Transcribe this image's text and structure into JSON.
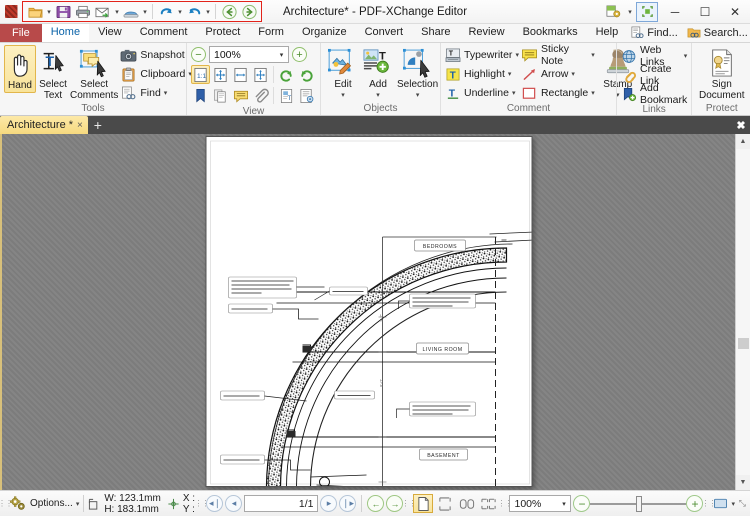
{
  "window": {
    "title": "Architecture* - PDF-XChange Editor",
    "minimize": "─",
    "maximize": "☐",
    "close": "✕"
  },
  "quick_access": {
    "icons": [
      "open-folder-icon",
      "save-icon",
      "print-icon",
      "email-icon",
      "scan-icon",
      "undo-icon",
      "redo-icon",
      "back-icon",
      "forward-icon"
    ]
  },
  "menu": {
    "file_label": "File",
    "tabs": [
      {
        "label": "Home",
        "active": true
      },
      {
        "label": "View",
        "active": false
      },
      {
        "label": "Comment",
        "active": false
      },
      {
        "label": "Protect",
        "active": false
      },
      {
        "label": "Form",
        "active": false
      },
      {
        "label": "Organize",
        "active": false
      },
      {
        "label": "Convert",
        "active": false
      },
      {
        "label": "Share",
        "active": false
      },
      {
        "label": "Review",
        "active": false
      },
      {
        "label": "Bookmarks",
        "active": false
      },
      {
        "label": "Help",
        "active": false
      }
    ],
    "find_label": "Find...",
    "search_label": "Search...",
    "collapse_chevron": "⌃"
  },
  "ribbon": {
    "groups": [
      {
        "title": "Tools",
        "big_buttons": [
          {
            "label": "Hand",
            "icon": "hand-icon",
            "selected": true
          },
          {
            "label": "Select\nText",
            "icon": "select-text-icon",
            "selected": false
          },
          {
            "label": "Select\nComments",
            "icon": "select-comments-icon",
            "selected": false
          }
        ],
        "small_buttons": [
          {
            "label": "Snapshot",
            "icon": "camera-icon",
            "has_caret": false
          },
          {
            "label": "Clipboard",
            "icon": "clipboard-icon",
            "has_caret": true
          },
          {
            "label": "Find",
            "icon": "find-icon",
            "has_caret": true
          }
        ]
      },
      {
        "title": "View",
        "zoom_value": "100%",
        "zoom_out": "−",
        "zoom_in": "+",
        "row1_icons": [
          "actual-size-icon",
          "fit-page-icon",
          "fit-width-icon",
          "fit-visible-icon",
          "rotate-ccw-icon",
          "rotate-cw-icon"
        ],
        "row2_icons": [
          "bookmarks-pane-icon",
          "thumbnails-pane-icon",
          "comments-pane-icon",
          "attachments-pane-icon",
          "content-pane-icon",
          "properties-pane-icon"
        ]
      },
      {
        "title": "Objects",
        "big_buttons": [
          {
            "label": "Edit",
            "icon": "edit-content-icon",
            "has_caret": true
          },
          {
            "label": "Add",
            "icon": "add-content-icon",
            "has_caret": true
          },
          {
            "label": "Selection",
            "icon": "selection-icon",
            "has_caret": true
          }
        ]
      },
      {
        "title": "Comment",
        "items": [
          {
            "label": "Typewriter",
            "icon": "typewriter-icon",
            "has_caret": true
          },
          {
            "label": "Sticky Note",
            "icon": "sticky-note-icon",
            "has_caret": true
          },
          {
            "label": "Highlight",
            "icon": "highlight-icon",
            "has_caret": true
          },
          {
            "label": "Arrow",
            "icon": "arrow-icon",
            "has_caret": true
          },
          {
            "label": "Underline",
            "icon": "underline-icon",
            "has_caret": true
          },
          {
            "label": "Rectangle",
            "icon": "rectangle-icon",
            "has_caret": true
          }
        ],
        "stamp_label": "Stamp",
        "stamp_icon": "stamp-icon"
      },
      {
        "title": "Links",
        "items": [
          {
            "label": "Web Links",
            "icon": "globe-icon",
            "has_caret": true
          },
          {
            "label": "Create Link",
            "icon": "chain-link-icon",
            "has_caret": false
          },
          {
            "label": "Add Bookmark",
            "icon": "add-bookmark-icon",
            "has_caret": false
          }
        ]
      },
      {
        "title": "Protect",
        "sign_label": "Sign\nDocument",
        "sign_icon": "certificate-icon"
      }
    ]
  },
  "document_tabs": {
    "tabs": [
      {
        "label": "Architecture *",
        "close": "×",
        "active": true
      }
    ],
    "new_tab": "+",
    "close_all": "✖"
  },
  "document": {
    "room_labels": [
      "BEDROOMS",
      "LIVING ROOM",
      "BASEMENT"
    ],
    "annotations": [
      "CONSULT THE WALL CLADDING\nLEGEND FOR ANCHOR\nBOLTS AND CONNECTIONS\nSCHEMA",
      "POUR LEDGE",
      "FORM SET AS",
      "POUR LEDGE",
      "TOP OF SLAB ELEVATION",
      "MIN 2 RAIL OR 1' OF INSULATION\nOVER SLAB AT SEE NOTE",
      "MIN 2 RAIL OR 1' OF INSULATION\nOVER SLAB AT SEE NOTE"
    ]
  },
  "status_bar": {
    "options_label": "Options...",
    "options_icon": "gears-icon",
    "size_icon": "page-size-icon",
    "width_label": "W: 123.1mm",
    "height_label": "H: 183.1mm",
    "cursor_icon": "crosshair-icon",
    "x_label": "X :",
    "y_label": "Y :",
    "page_value": "1/1",
    "nav_first": "◂❘",
    "nav_prev": "◂",
    "nav_next": "▸",
    "nav_last": "❘▸",
    "history_back": "←",
    "history_forward": "→",
    "view_modes": [
      "single-page-icon",
      "continuous-icon",
      "two-page-icon",
      "two-page-continuous-icon"
    ],
    "view_mode_selected": 0,
    "zoom_value": "100%",
    "zoom_out": "−",
    "zoom_in": "+",
    "fullscreen_icon": "fullscreen-icon",
    "fullscreen_caret": "▾",
    "resize_grip": "⤡"
  }
}
